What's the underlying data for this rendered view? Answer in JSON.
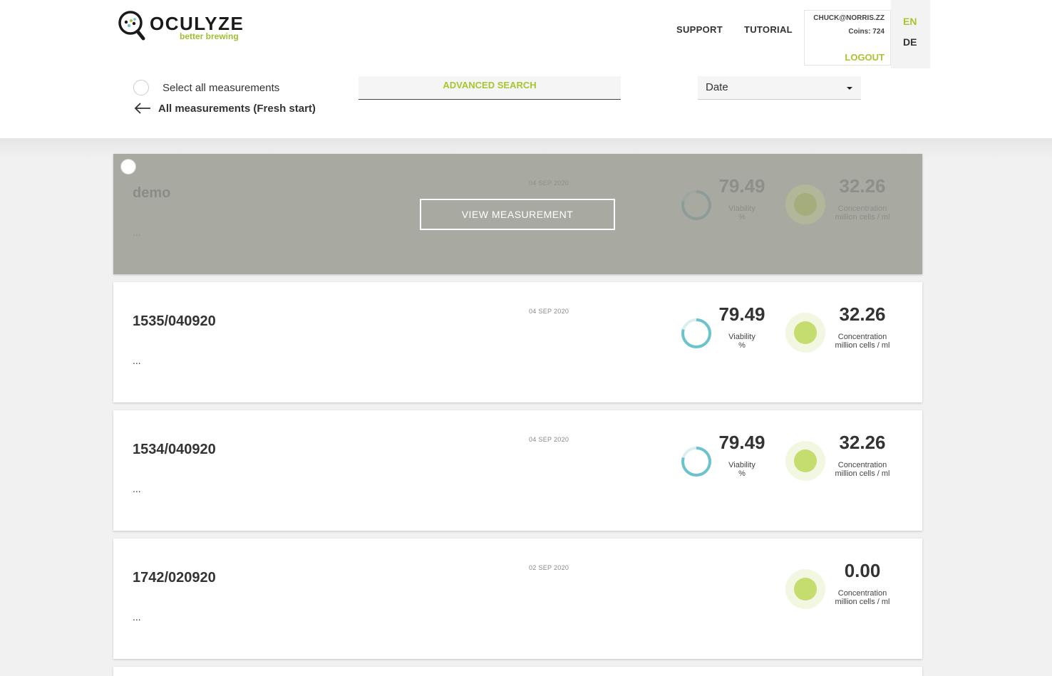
{
  "brand": {
    "name": "OCULYZE",
    "tagline": "better brewing"
  },
  "nav": {
    "support": "SUPPORT",
    "tutorial": "TUTORIAL"
  },
  "account": {
    "email": "CHUCK@NORRIS.ZZ",
    "coins": "Coins: 724",
    "logout": "LOGOUT"
  },
  "languages": {
    "en": "EN",
    "de": "DE"
  },
  "toolbar": {
    "select_all": "Select all measurements",
    "back": "All measurements (Fresh start)",
    "advanced_search": "ADVANCED SEARCH",
    "sort_value": "Date"
  },
  "measurements": [
    {
      "title": "demo",
      "date": "04 SEP 2020",
      "description": "...",
      "viability": "79.49",
      "viability_label": "Viability",
      "viability_unit": "%",
      "concentration": "32.26",
      "concentration_label": "Concentration",
      "concentration_unit": "million cells / ml",
      "view_button": "VIEW MEASUREMENT"
    },
    {
      "title": "1535/040920",
      "date": "04 SEP 2020",
      "description": "...",
      "viability": "79.49",
      "viability_label": "Viability",
      "viability_unit": "%",
      "concentration": "32.26",
      "concentration_label": "Concentration",
      "concentration_unit": "million cells / ml"
    },
    {
      "title": "1534/040920",
      "date": "04 SEP 2020",
      "description": "...",
      "viability": "79.49",
      "viability_label": "Viability",
      "viability_unit": "%",
      "concentration": "32.26",
      "concentration_label": "Concentration",
      "concentration_unit": "million cells / ml"
    },
    {
      "title": "1742/020920",
      "date": "02 SEP 2020",
      "description": "...",
      "concentration": "0.00",
      "concentration_label": "Concentration",
      "concentration_unit": "million cells / ml"
    }
  ],
  "colors": {
    "accent": "#a8c531",
    "viability_ring": "#6cc3cc",
    "concentration_dot": "#c5dc6f",
    "hover_overlay": "#a8aaa1"
  },
  "icons": {
    "logo": "magnifier-logo-icon",
    "back": "arrow-left-icon",
    "caret": "caret-down-icon",
    "viability": "ring-gauge-icon",
    "concentration": "dot-icon"
  }
}
